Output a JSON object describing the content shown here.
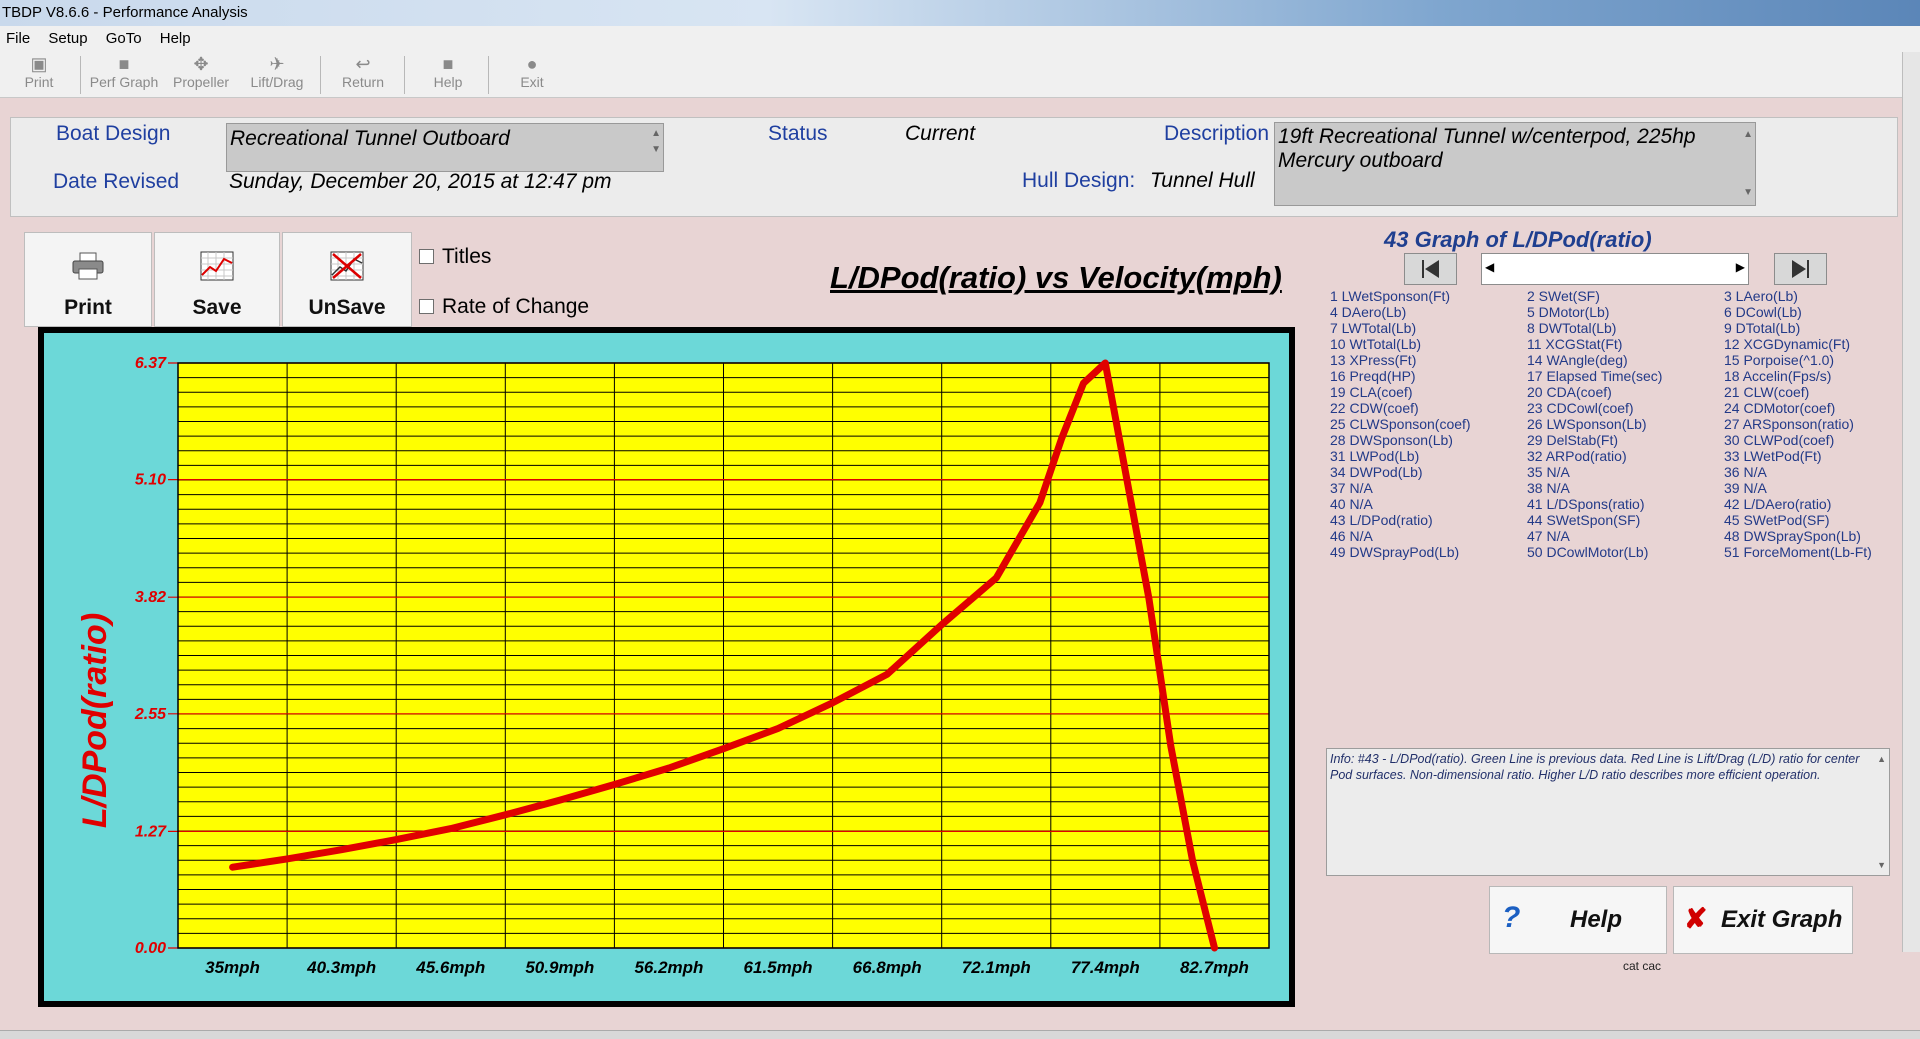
{
  "window": {
    "title": "TBDP V8.6.6 - Performance Analysis"
  },
  "menu": [
    "File",
    "Setup",
    "GoTo",
    "Help"
  ],
  "toolbar": {
    "print": "Print",
    "perf_graph": "Perf Graph",
    "propeller": "Propeller",
    "lift_drag": "Lift/Drag",
    "return": "Return",
    "help": "Help",
    "exit": "Exit"
  },
  "header": {
    "boat_design_label": "Boat Design",
    "boat_design_value": "Recreational Tunnel Outboard",
    "date_revised_label": "Date Revised",
    "date_revised_value": "Sunday, December 20, 2015 at 12:47 pm",
    "status_label": "Status",
    "status_value": "Current",
    "hull_design_label": "Hull Design:",
    "hull_design_value": "Tunnel Hull",
    "description_label": "Description",
    "description_value": "19ft Recreational Tunnel w/centerpod, 225hp Mercury outboard"
  },
  "buttons": {
    "print": "Print",
    "save": "Save",
    "unsave": "UnSave"
  },
  "options": {
    "titles": "Titles",
    "rate_of_change": "Rate of Change"
  },
  "chart_data": {
    "type": "line",
    "title": "L/DPod(ratio) vs Velocity(mph)",
    "ylabel": "L/DPod(ratio)",
    "xlabel": "",
    "categories": [
      "35mph",
      "40.3mph",
      "45.6mph",
      "50.9mph",
      "56.2mph",
      "61.5mph",
      "66.8mph",
      "72.1mph",
      "77.4mph",
      "82.7mph"
    ],
    "y_ticks": [
      "6.37",
      "5.10",
      "3.82",
      "2.55",
      "1.27",
      "0.00"
    ],
    "ylim": [
      0,
      6.37
    ],
    "series": [
      {
        "color": "#e00000",
        "x": [
          0.0,
          0.5,
          1.0,
          1.5,
          2.0,
          2.5,
          3.0,
          3.5,
          4.0,
          4.5,
          5.0,
          5.5,
          6.0,
          6.5,
          7.0,
          7.4,
          7.6,
          7.8,
          8.0,
          8.4,
          8.6,
          8.8,
          9.0
        ],
        "values": [
          0.88,
          0.97,
          1.07,
          1.18,
          1.3,
          1.45,
          1.61,
          1.78,
          1.96,
          2.17,
          2.39,
          2.67,
          2.98,
          3.52,
          4.03,
          4.85,
          5.55,
          6.15,
          6.37,
          3.8,
          2.2,
          0.95,
          0.0
        ]
      }
    ],
    "grid": true,
    "plot_bg": "#ffff00",
    "frame_bg": "#6cd8d8"
  },
  "graph_panel": {
    "title": "43 Graph of L/DPod(ratio)",
    "variables": [
      [
        "1 LWetSponson(Ft)",
        "4 DAero(Lb)",
        "7 LWTotal(Lb)",
        "10 WtTotal(Lb)",
        "13 XPress(Ft)",
        "16 Preqd(HP)",
        "19 CLA(coef)",
        "22 CDW(coef)",
        "25 CLWSponson(coef)",
        "28 DWSponson(Lb)",
        "31 LWPod(Lb)",
        "34 DWPod(Lb)",
        "37 N/A",
        "40 N/A",
        "43 L/DPod(ratio)",
        "46 N/A",
        "49 DWSprayPod(Lb)"
      ],
      [
        "2 SWet(SF)",
        "5 DMotor(Lb)",
        "8 DWTotal(Lb)",
        "11 XCGStat(Ft)",
        "14 WAngle(deg)",
        "17 Elapsed Time(sec)",
        "20 CDA(coef)",
        "23 CDCowl(coef)",
        "26 LWSponson(Lb)",
        "29 DelStab(Ft)",
        "32 ARPod(ratio)",
        "35 N/A",
        "38 N/A",
        "41 L/DSpons(ratio)",
        "44 SWetSpon(SF)",
        "47 N/A",
        "50 DCowlMotor(Lb)"
      ],
      [
        "3 LAero(Lb)",
        "6 DCowl(Lb)",
        "9 DTotal(Lb)",
        "12 XCGDynamic(Ft)",
        "15 Porpoise(^1.0)",
        "18 Accelin(Fps/s)",
        "21 CLW(coef)",
        "24 CDMotor(coef)",
        "27 ARSponson(ratio)",
        "30 CLWPod(coef)",
        "33 LWetPod(Ft)",
        "36 N/A",
        "39 N/A",
        "42 L/DAero(ratio)",
        "45 SWetPod(SF)",
        "48 DWSpraySpon(Lb)",
        "51 ForceMoment(Lb-Ft)"
      ]
    ],
    "info": "Info: #43 - L/DPod(ratio). Green Line is previous data. Red Line is Lift/Drag (L/D) ratio for center Pod surfaces.  Non-dimensional ratio.  Higher L/D ratio describes more efficient operation.",
    "help_button": "Help",
    "exit_button": "Exit Graph",
    "footer_text": "cat cac"
  }
}
